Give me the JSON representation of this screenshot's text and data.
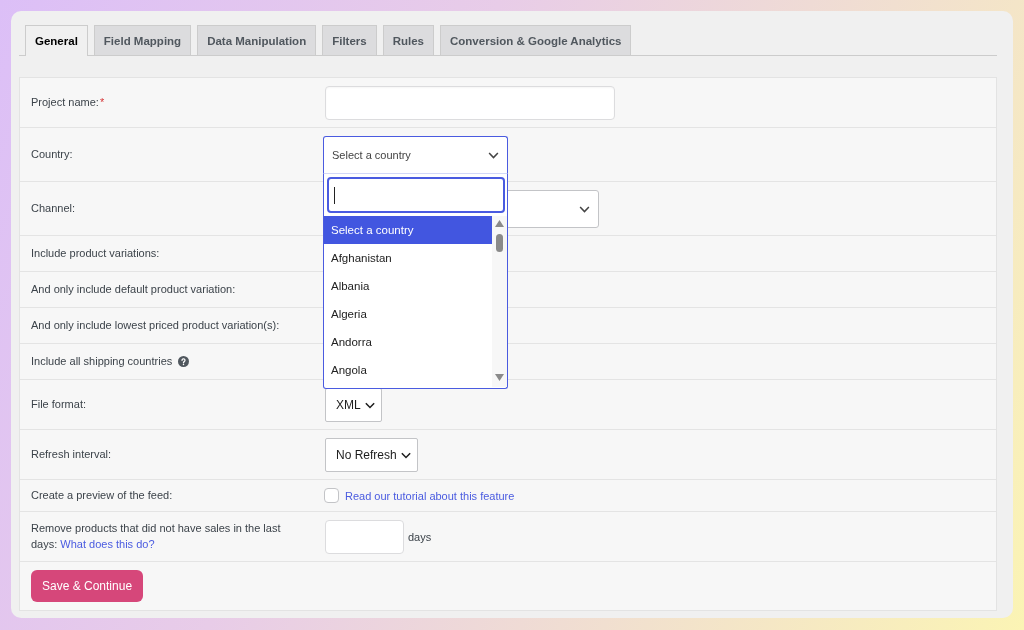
{
  "tabs": [
    {
      "label": "General",
      "selected": true
    },
    {
      "label": "Field Mapping",
      "selected": false
    },
    {
      "label": "Data Manipulation",
      "selected": false
    },
    {
      "label": "Filters",
      "selected": false
    },
    {
      "label": "Rules",
      "selected": false
    },
    {
      "label": "Conversion & Google Analytics",
      "selected": false
    }
  ],
  "form": {
    "rows": [
      {
        "kind": "text",
        "label": "Project name:",
        "required_mark": "*"
      },
      {
        "kind": "search_select",
        "label": "Country:",
        "value": "Select a country",
        "expanded": true,
        "dropdown": {
          "search": {
            "focused": true
          },
          "options": [
            {
              "label": "Select a country",
              "selected": true
            },
            {
              "label": "Afghanistan",
              "selected": false
            },
            {
              "label": "Albania",
              "selected": false
            },
            {
              "label": "Algeria",
              "selected": false
            },
            {
              "label": "Andorra",
              "selected": false
            },
            {
              "label": "Angola",
              "selected": false
            }
          ]
        }
      },
      {
        "kind": "search_select",
        "label": "Channel:",
        "expanded": false
      },
      {
        "kind": "covered",
        "label": "Include product variations:"
      },
      {
        "kind": "covered",
        "label": "And only include default product variation:"
      },
      {
        "kind": "covered",
        "label": "And only include lowest priced product variation(s):"
      },
      {
        "kind": "covered",
        "label": "Include all shipping countries",
        "help_icon": true
      },
      {
        "kind": "select",
        "label": "File format:",
        "value": "XML"
      },
      {
        "kind": "select",
        "label": "Refresh interval:",
        "value": "No Refresh"
      },
      {
        "kind": "checkbox",
        "label": "Create a preview of the feed:",
        "checked": false,
        "link": "Read our tutorial about this feature"
      },
      {
        "kind": "number",
        "label": "Remove products that did not have sales in the last days:",
        "link": "What does this do?",
        "suffix": "days"
      }
    ]
  },
  "save_button": {
    "label": "Save & Continue"
  }
}
